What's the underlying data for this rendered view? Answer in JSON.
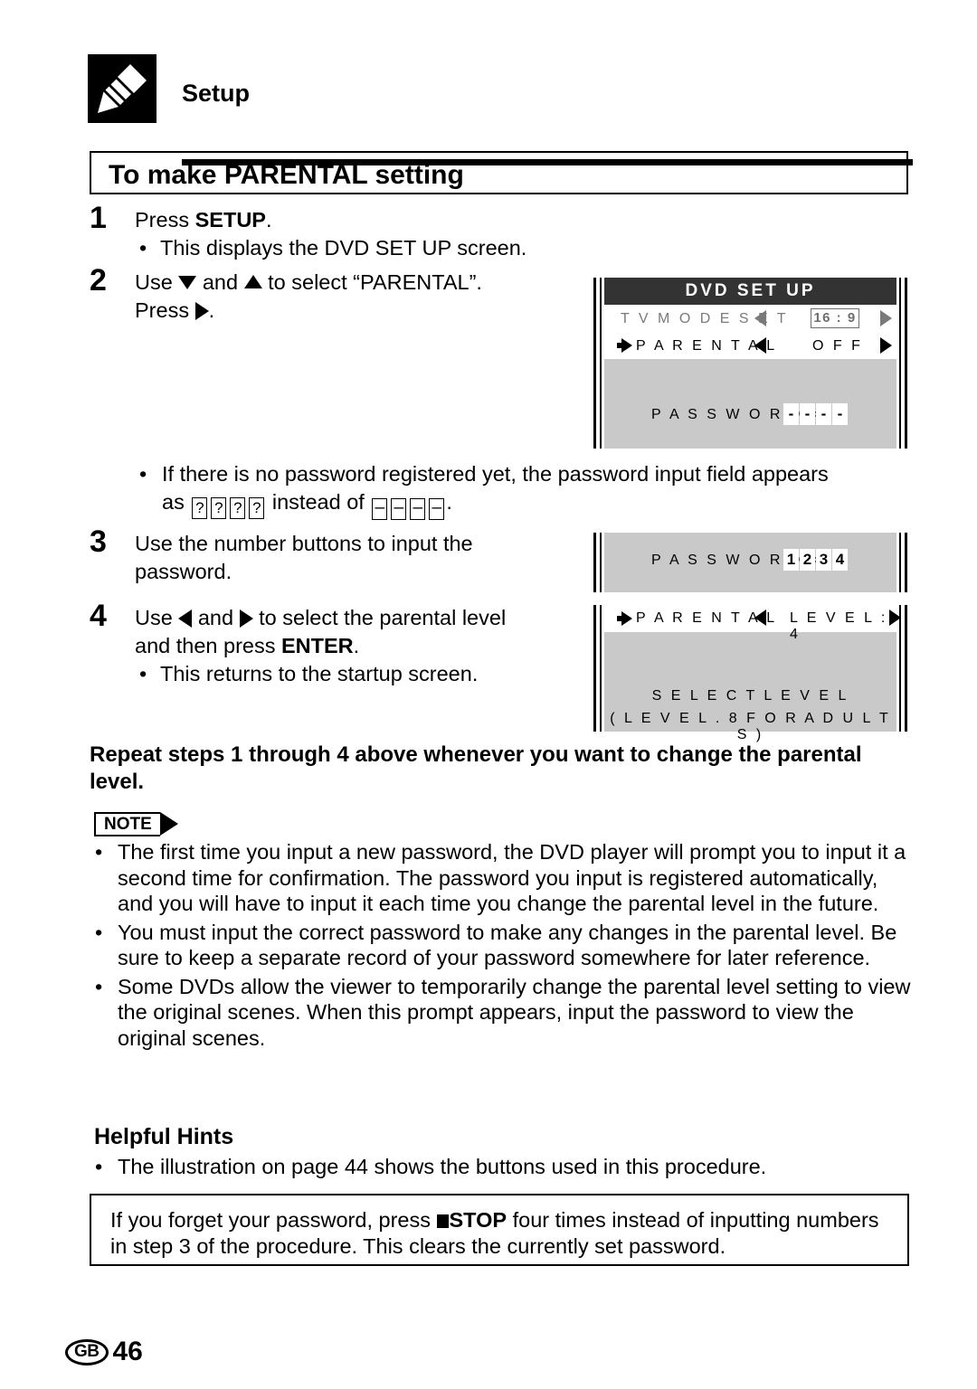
{
  "header": {
    "icon": "plug-connector-icon",
    "chapter_title": "Setup"
  },
  "section": {
    "title": "To make PARENTAL setting"
  },
  "steps": [
    {
      "number": "1",
      "text_parts": [
        "Press ",
        "SETUP",
        "."
      ],
      "bullet": "This displays the DVD SET UP screen."
    },
    {
      "number": "2",
      "line1_a": "Use ",
      "line1_b": " and ",
      "line1_c": " to select “PARENTAL”.",
      "line2_a": "Press ",
      "line2_b": "."
    },
    {
      "number": "3",
      "text": "Use the number buttons to input the password."
    },
    {
      "number": "4",
      "line1_a": "Use ",
      "line1_b": " and ",
      "line1_c": " to select the parental level",
      "line2_a": "and then press ",
      "line2_b": "ENTER",
      "line2_c": ".",
      "bullet": "This returns to the startup screen."
    }
  ],
  "no_password_note": {
    "line1": "If there is no password registered yet, the password input field appears",
    "line2_a": "as",
    "line2_q": "?",
    "line2_b": "instead of",
    "line2_dash": "–",
    "line2_c": "."
  },
  "osd_screen_1": {
    "title": "DVD  SET  UP",
    "row1_label": "T V   M O D E   S E T",
    "row1_value": "16 : 9",
    "row2_label": "P A R E N T A L",
    "row2_value": "O F F",
    "password_label": "P A S S W O R D   =",
    "password_digits": [
      "-",
      "-",
      "-",
      "-"
    ]
  },
  "osd_screen_2": {
    "password_label": "P A S S W O R D   =",
    "password_digits": [
      "1",
      "2",
      "3",
      "4"
    ]
  },
  "osd_screen_3": {
    "row_label": "P A R E N T A L",
    "row_value": "L E V E L : 4",
    "center_line1": "S E L E C T   L E V E L",
    "center_line2": "(    L E V E L . 8   F O R   A D U L T S    )"
  },
  "repeat_line": "Repeat steps 1 through 4 above whenever you want to change the parental level.",
  "note": {
    "badge_label": "NOTE",
    "items": [
      "The first time you input a new password, the DVD player will prompt you to input it a second time for confirmation. The password you input is registered automatically, and you will have to input it each time you change the parental level in the future.",
      "You must input the correct password to make any changes in the parental level. Be sure to keep a separate record of your password somewhere for later reference.",
      "Some DVDs allow the viewer to temporarily change the parental level setting to view the original scenes. When this prompt appears, input the password to view the original scenes."
    ]
  },
  "hints": {
    "title": "Helpful Hints",
    "item": "The illustration on page 44 shows the buttons used in this procedure."
  },
  "callout": {
    "part1": "If you forget your password, press ",
    "stop_label": "STOP",
    "part2": " four times instead of inputting numbers in step 3 of the procedure. This clears the currently set password."
  },
  "footer": {
    "region": "GB",
    "page_number": "46"
  },
  "colors": {
    "osd_header_bg": "#333333",
    "osd_body_bg": "#c9c9c9",
    "osd_dim_text": "#7a7a7a",
    "ink": "#000000",
    "paper": "#ffffff"
  }
}
